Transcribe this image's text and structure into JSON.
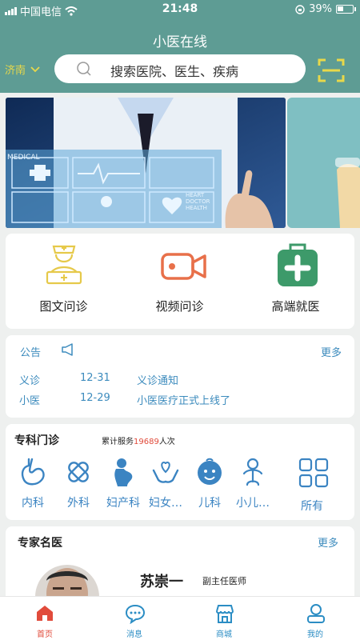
{
  "status_bar": {
    "carrier": "中国电信",
    "time": "21:48",
    "battery": "39%",
    "battery_level": 0.39
  },
  "header": {
    "title": "小医在线",
    "city": "济南",
    "search_placeholder": "搜索医院、医生、疾病"
  },
  "banner": {
    "panel_words": [
      "MEDICAL",
      "HEART",
      "DOCTOR",
      "HEALTH"
    ]
  },
  "quick_actions": [
    {
      "label": "图文问诊",
      "icon": "doctor-icon",
      "color": "#e6c94a"
    },
    {
      "label": "视频问诊",
      "icon": "video-camera-icon",
      "color": "#e8704a"
    },
    {
      "label": "高端就医",
      "icon": "medical-kit-icon",
      "color": "#3d9a6a"
    }
  ],
  "notice": {
    "title": "公告",
    "more": "更多",
    "items": [
      {
        "tag": "义诊",
        "date": "12-31",
        "text": "义诊通知"
      },
      {
        "tag": "小医",
        "date": "12-29",
        "text": "小医医疗正式上线了"
      }
    ]
  },
  "departments": {
    "title": "专科门诊",
    "served_prefix": "累计服务",
    "served_count": "19689",
    "served_suffix": "人次",
    "items": [
      {
        "label": "内科",
        "icon": "stomach-icon"
      },
      {
        "label": "外科",
        "icon": "bandage-icon"
      },
      {
        "label": "妇产科",
        "icon": "pregnant-woman-icon"
      },
      {
        "label": "妇女…",
        "icon": "heart-hands-icon"
      },
      {
        "label": "儿科",
        "icon": "baby-face-icon"
      },
      {
        "label": "小儿…",
        "icon": "child-icon"
      },
      {
        "label": "所有",
        "icon": "grid-icon"
      }
    ],
    "accent": "#3b84c2"
  },
  "experts": {
    "title": "专家名医",
    "more": "更多",
    "doctor": {
      "name": "苏崇一",
      "title": "副主任医师"
    }
  },
  "tabbar": [
    {
      "label": "首页",
      "icon": "home-icon",
      "active": true
    },
    {
      "label": "消息",
      "icon": "message-icon",
      "active": false
    },
    {
      "label": "商城",
      "icon": "store-icon",
      "active": false
    },
    {
      "label": "我的",
      "icon": "user-icon",
      "active": false
    }
  ]
}
